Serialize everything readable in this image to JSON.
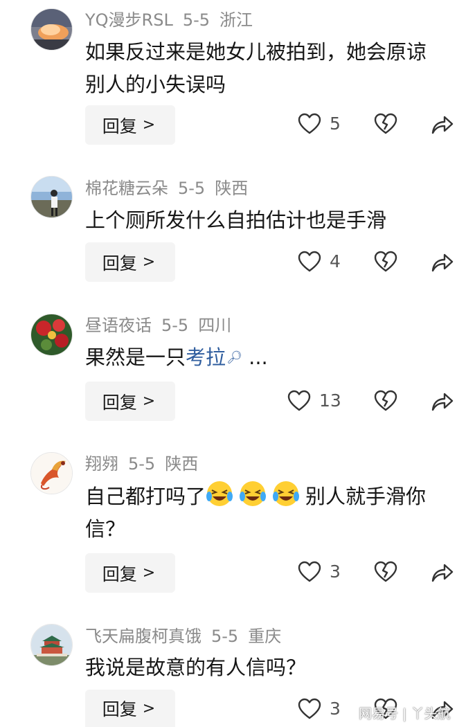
{
  "comments": [
    {
      "username": "YQ漫步RSL",
      "date": "5-5",
      "location": "浙江",
      "text_line1": "如果反过来是她女儿被拍到，她会原谅",
      "text_line2": "别人的小失误吗",
      "reply_label": "回复",
      "likes": "5",
      "avatar_icon": "sunset-cloud-avatar"
    },
    {
      "username": "棉花糖云朵",
      "date": "5-5",
      "location": "陕西",
      "text_line1": "上个厕所发什么自拍估计也是手滑",
      "reply_label": "回复",
      "likes": "4",
      "avatar_icon": "person-outdoor-avatar"
    },
    {
      "username": "昼语夜话",
      "date": "5-5",
      "location": "四川",
      "text_before_link": "果然是一只",
      "link_text": "考拉",
      "text_after_link": " ...",
      "reply_label": "回复",
      "likes": "13",
      "avatar_icon": "red-flower-avatar"
    },
    {
      "username": "翔翙",
      "date": "5-5",
      "location": "陕西",
      "text_before_emoji": "自己都打吗了",
      "text_after_emoji": "别人就手滑你",
      "text_line2": "信？",
      "emoji_icon": "laughing-crying-emoji",
      "reply_label": "回复",
      "likes": "3",
      "avatar_icon": "phoenix-bird-avatar"
    },
    {
      "username": "飞天扁腹柯真饿",
      "date": "5-5",
      "location": "重庆",
      "text_line1": "我说是故意的有人信吗？",
      "reply_label": "回复",
      "likes": "3",
      "avatar_icon": "temple-building-avatar"
    }
  ],
  "icons": {
    "like": "heart-outline-icon",
    "dislike": "broken-heart-icon",
    "share": "share-arrow-icon",
    "reply_chevron": "chevron-right-icon",
    "link_search": "search-icon"
  },
  "watermark": "网易号 | 丫头航",
  "colors": {
    "meta": "#8a8a8a",
    "link": "#2f5d9e",
    "reply_bg": "#f4f4f4"
  }
}
